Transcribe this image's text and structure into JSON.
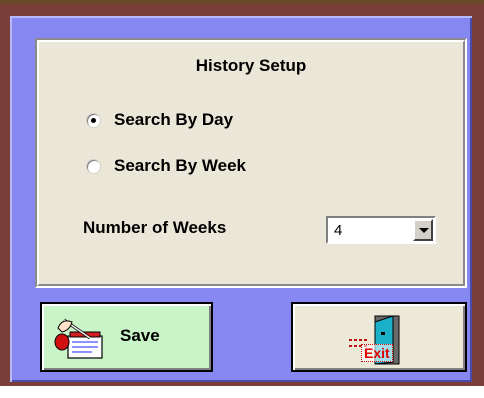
{
  "dialog": {
    "group_title": "History Setup",
    "radios": [
      {
        "label": "Search By Day",
        "checked": true
      },
      {
        "label": "Search By Week",
        "checked": false
      }
    ],
    "weeks_label": "Number of Weeks",
    "weeks_value": "4",
    "save_label": "Save",
    "exit_label": "Exit"
  },
  "colors": {
    "frame": "#7b3f3a",
    "panel": "#8787f2",
    "group_bg": "#ebe7d8",
    "save_bg": "#c8f4c8",
    "exit_text": "#e00000"
  },
  "icons": {
    "save": "save-notepad-icon",
    "exit": "exit-door-icon"
  }
}
